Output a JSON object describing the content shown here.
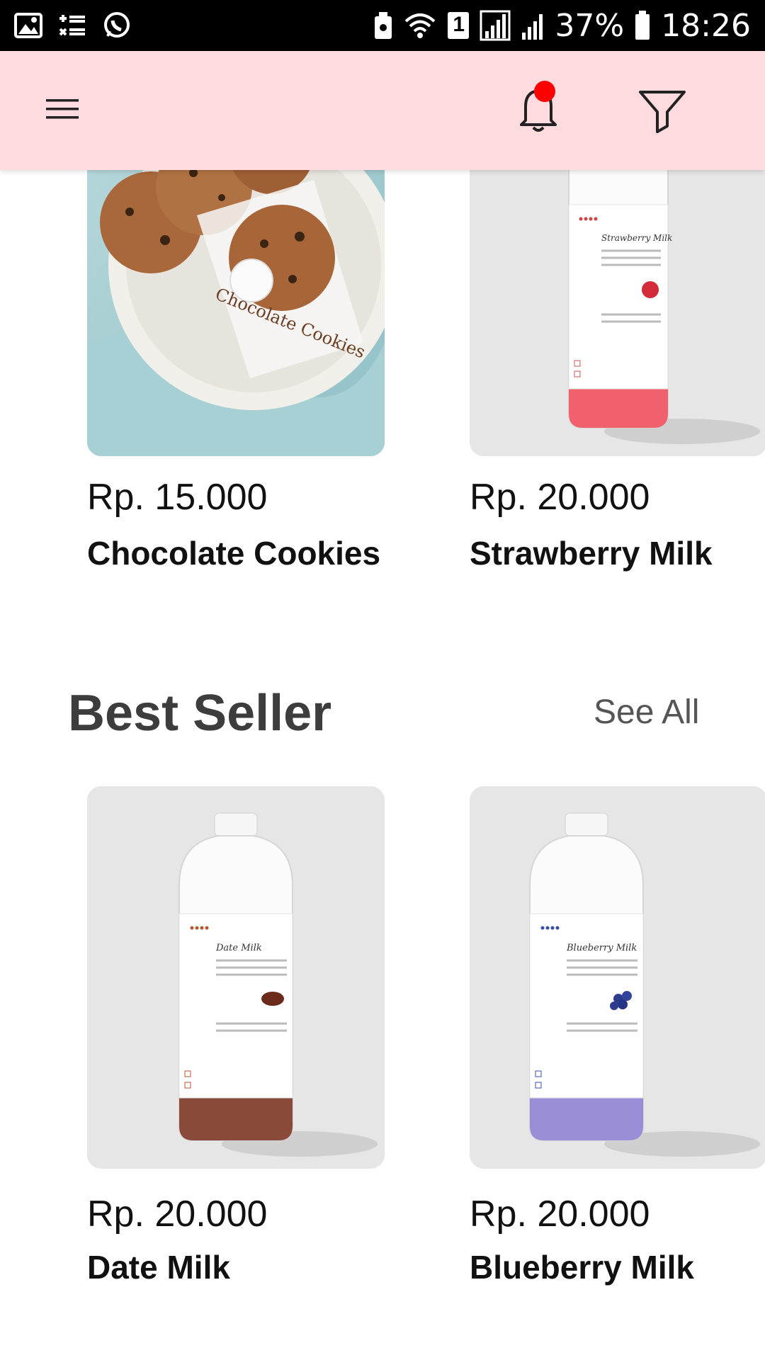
{
  "status_bar": {
    "battery_percent": "37%",
    "time": "18:26",
    "sim_badge": "1",
    "icons": [
      "image-icon",
      "tasks-icon",
      "whatsapp-icon",
      "usb-icon",
      "wifi-icon",
      "sim-icon",
      "signal-icon",
      "signal-icon",
      "battery-icon"
    ]
  },
  "app_bar": {
    "background": "#ffdbe0",
    "icons": [
      "hamburger-menu-icon",
      "bell-icon",
      "filter-icon"
    ],
    "notification_dot_color": "#ff0000"
  },
  "products_top": [
    {
      "price": "Rp. 15.000",
      "name": "Chocolate Cookies",
      "image": "chocolate-cookies-photo",
      "label_text": "Chocolate Cookies"
    },
    {
      "price": "Rp. 20.000",
      "name": "Strawberry Milk",
      "image": "strawberry-milk-bottle",
      "label_text": "Strawberry Milk",
      "liquid_color": "#f0616d"
    }
  ],
  "best_seller": {
    "title": "Best Seller",
    "see_all": "See All",
    "products": [
      {
        "price": "Rp. 20.000",
        "name": "Date Milk",
        "image": "date-milk-bottle",
        "label_text": "Date Milk",
        "liquid_color": "#8a4a3a"
      },
      {
        "price": "Rp. 20.000",
        "name": "Blueberry Milk",
        "image": "blueberry-milk-bottle",
        "label_text": "Blueberry Milk",
        "liquid_color": "#9a8fd6"
      }
    ]
  }
}
